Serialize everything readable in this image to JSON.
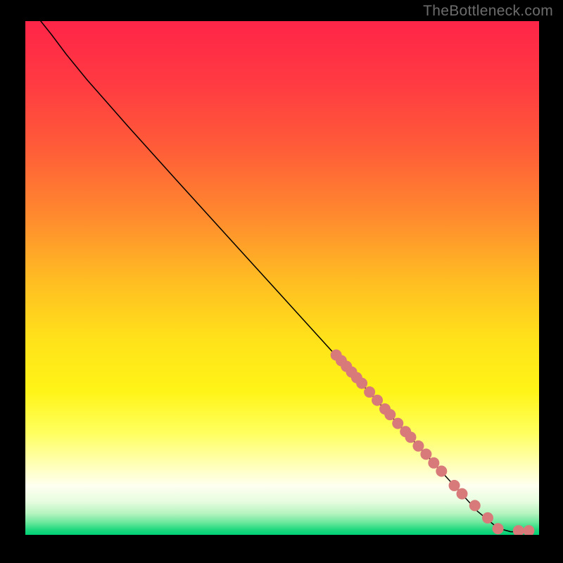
{
  "watermark_text": "TheBottleneck.com",
  "chart_data": {
    "type": "line",
    "title": "",
    "xlabel": "",
    "ylabel": "",
    "xlim": [
      0,
      100
    ],
    "ylim": [
      0,
      100
    ],
    "background_gradient": {
      "stops": [
        {
          "pos": 0.0,
          "color": "#ff2548"
        },
        {
          "pos": 0.12,
          "color": "#ff3a42"
        },
        {
          "pos": 0.25,
          "color": "#ff5d38"
        },
        {
          "pos": 0.38,
          "color": "#ff8a2e"
        },
        {
          "pos": 0.5,
          "color": "#ffbb23"
        },
        {
          "pos": 0.62,
          "color": "#ffe21a"
        },
        {
          "pos": 0.72,
          "color": "#fff417"
        },
        {
          "pos": 0.8,
          "color": "#ffff5d"
        },
        {
          "pos": 0.86,
          "color": "#ffffb2"
        },
        {
          "pos": 0.905,
          "color": "#fefff0"
        },
        {
          "pos": 0.935,
          "color": "#e7fde0"
        },
        {
          "pos": 0.958,
          "color": "#b7f4c0"
        },
        {
          "pos": 0.976,
          "color": "#6be89c"
        },
        {
          "pos": 0.99,
          "color": "#1fd87e"
        },
        {
          "pos": 1.0,
          "color": "#00d075"
        }
      ]
    },
    "series": [
      {
        "name": "curve",
        "stroke": "#000000",
        "stroke_width": 1.5,
        "points": [
          {
            "x": 3.0,
            "y": 100.0
          },
          {
            "x": 5.0,
            "y": 97.5
          },
          {
            "x": 8.0,
            "y": 93.5
          },
          {
            "x": 12.0,
            "y": 88.6
          },
          {
            "x": 20.0,
            "y": 79.5
          },
          {
            "x": 30.0,
            "y": 68.4
          },
          {
            "x": 40.0,
            "y": 57.4
          },
          {
            "x": 50.0,
            "y": 46.4
          },
          {
            "x": 60.0,
            "y": 35.4
          },
          {
            "x": 70.0,
            "y": 24.4
          },
          {
            "x": 80.0,
            "y": 13.4
          },
          {
            "x": 88.0,
            "y": 4.6
          },
          {
            "x": 92.0,
            "y": 1.3
          },
          {
            "x": 94.5,
            "y": 0.6
          },
          {
            "x": 97.5,
            "y": 0.6
          }
        ]
      }
    ],
    "markers": {
      "color": "#d97a7a",
      "radius": 8,
      "points": [
        {
          "x": 60.5,
          "y": 35.0
        },
        {
          "x": 61.5,
          "y": 33.9
        },
        {
          "x": 62.5,
          "y": 32.8
        },
        {
          "x": 63.5,
          "y": 31.7
        },
        {
          "x": 64.5,
          "y": 30.6
        },
        {
          "x": 65.5,
          "y": 29.5
        },
        {
          "x": 67.0,
          "y": 27.8
        },
        {
          "x": 68.5,
          "y": 26.2
        },
        {
          "x": 70.0,
          "y": 24.5
        },
        {
          "x": 71.0,
          "y": 23.4
        },
        {
          "x": 72.5,
          "y": 21.7
        },
        {
          "x": 74.0,
          "y": 20.1
        },
        {
          "x": 75.0,
          "y": 19.0
        },
        {
          "x": 76.5,
          "y": 17.3
        },
        {
          "x": 78.0,
          "y": 15.7
        },
        {
          "x": 79.5,
          "y": 14.0
        },
        {
          "x": 81.0,
          "y": 12.4
        },
        {
          "x": 83.5,
          "y": 9.6
        },
        {
          "x": 85.0,
          "y": 8.0
        },
        {
          "x": 87.5,
          "y": 5.7
        },
        {
          "x": 90.0,
          "y": 3.3
        },
        {
          "x": 92.0,
          "y": 1.2
        },
        {
          "x": 96.0,
          "y": 0.8
        },
        {
          "x": 98.0,
          "y": 0.8
        }
      ]
    }
  }
}
